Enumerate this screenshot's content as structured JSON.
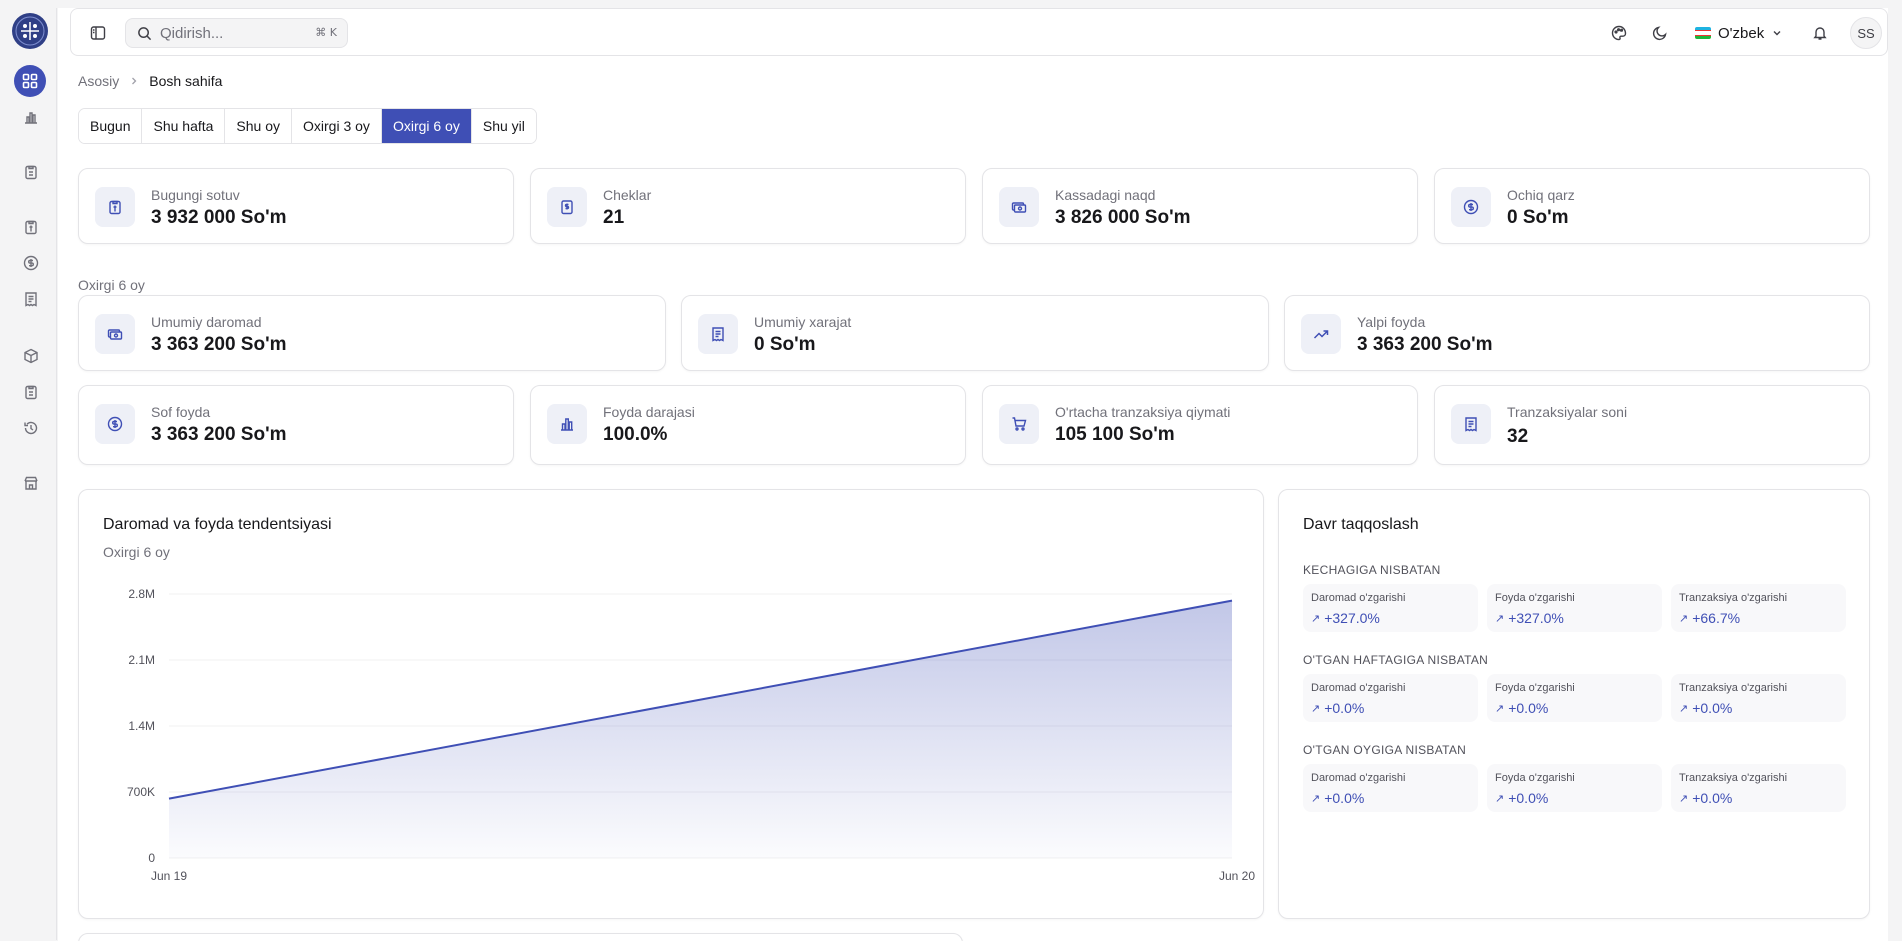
{
  "topbar": {
    "search_placeholder": "Qidirish...",
    "search_shortcut": "⌘ K",
    "language": "O'zbek",
    "user_initials": "SS"
  },
  "breadcrumb": {
    "parent": "Asosiy",
    "current": "Bosh sahifa"
  },
  "period_tabs": [
    {
      "label": "Bugun",
      "active": false
    },
    {
      "label": "Shu hafta",
      "active": false
    },
    {
      "label": "Shu oy",
      "active": false
    },
    {
      "label": "Oxirgi 3 oy",
      "active": false
    },
    {
      "label": "Oxirgi 6 oy",
      "active": true
    },
    {
      "label": "Shu yil",
      "active": false
    }
  ],
  "today_stats": [
    {
      "label": "Bugungi sotuv",
      "value": "3 932 000 So'm",
      "icon": "receipt-icon"
    },
    {
      "label": "Cheklar",
      "value": "21",
      "icon": "receipt-dollar-icon"
    },
    {
      "label": "Kassadagi naqd",
      "value": "3 826 000 So'm",
      "icon": "cash-icon"
    },
    {
      "label": "Ochiq qarz",
      "value": "0 So'm",
      "icon": "dollar-circle-icon"
    }
  ],
  "period_label": "Oxirgi 6 oy",
  "period_stats": [
    {
      "label": "Umumiy daromad",
      "value": "3 363 200 So'm",
      "icon": "cash-icon"
    },
    {
      "label": "Umumiy xarajat",
      "value": "0 So'm",
      "icon": "document-icon"
    },
    {
      "label": "Yalpi foyda",
      "value": "3 363 200 So'm",
      "icon": "trending-up-icon"
    }
  ],
  "period_stats2": [
    {
      "label": "Sof foyda",
      "value": "3 363 200 So'm",
      "icon": "dollar-circle-icon"
    },
    {
      "label": "Foyda darajasi",
      "value": "100.0%",
      "icon": "bar-chart-icon"
    },
    {
      "label": "O'rtacha tranzaksiya qiymati",
      "value": "105 100 So'm",
      "icon": "cart-icon"
    },
    {
      "label": "Tranzaksiyalar soni",
      "value": "32",
      "icon": "receipt-icon"
    }
  ],
  "trend": {
    "title": "Daromad va foyda tendentsiyasi",
    "subtitle": "Oxirgi 6 oy"
  },
  "chart_data": {
    "type": "area",
    "title": "Daromad va foyda tendentsiyasi",
    "subtitle": "Oxirgi 6 oy",
    "x": [
      "Jun 19",
      "Jun 20"
    ],
    "series": [
      {
        "values": [
          630000,
          2730000
        ]
      }
    ],
    "yticks": [
      0,
      700000,
      1400000,
      2100000,
      2800000
    ],
    "ytick_labels": [
      "0",
      "700K",
      "1.4M",
      "2.1M",
      "2.8M"
    ],
    "ylim": [
      0,
      2800000
    ],
    "color": "#3f4fb5",
    "grid": true
  },
  "comparison": {
    "title": "Davr taqqoslash",
    "groups": [
      {
        "label": "KECHAGIGA NISBATAN",
        "items": [
          {
            "label": "Daromad o'zgarishi",
            "value": "+327.0%"
          },
          {
            "label": "Foyda o'zgarishi",
            "value": "+327.0%"
          },
          {
            "label": "Tranzaksiya o'zgarishi",
            "value": "+66.7%"
          }
        ]
      },
      {
        "label": "O'TGAN HAFTAGIGA NISBATAN",
        "items": [
          {
            "label": "Daromad o'zgarishi",
            "value": "+0.0%"
          },
          {
            "label": "Foyda o'zgarishi",
            "value": "+0.0%"
          },
          {
            "label": "Tranzaksiya o'zgarishi",
            "value": "+0.0%"
          }
        ]
      },
      {
        "label": "O'TGAN OYGIGA NISBATAN",
        "items": [
          {
            "label": "Daromad o'zgarishi",
            "value": "+0.0%"
          },
          {
            "label": "Foyda o'zgarishi",
            "value": "+0.0%"
          },
          {
            "label": "Tranzaksiya o'zgarishi",
            "value": "+0.0%"
          }
        ]
      }
    ]
  },
  "colors": {
    "accent": "#3f4fb5",
    "border": "#e4e4e7",
    "muted": "#71717a"
  }
}
